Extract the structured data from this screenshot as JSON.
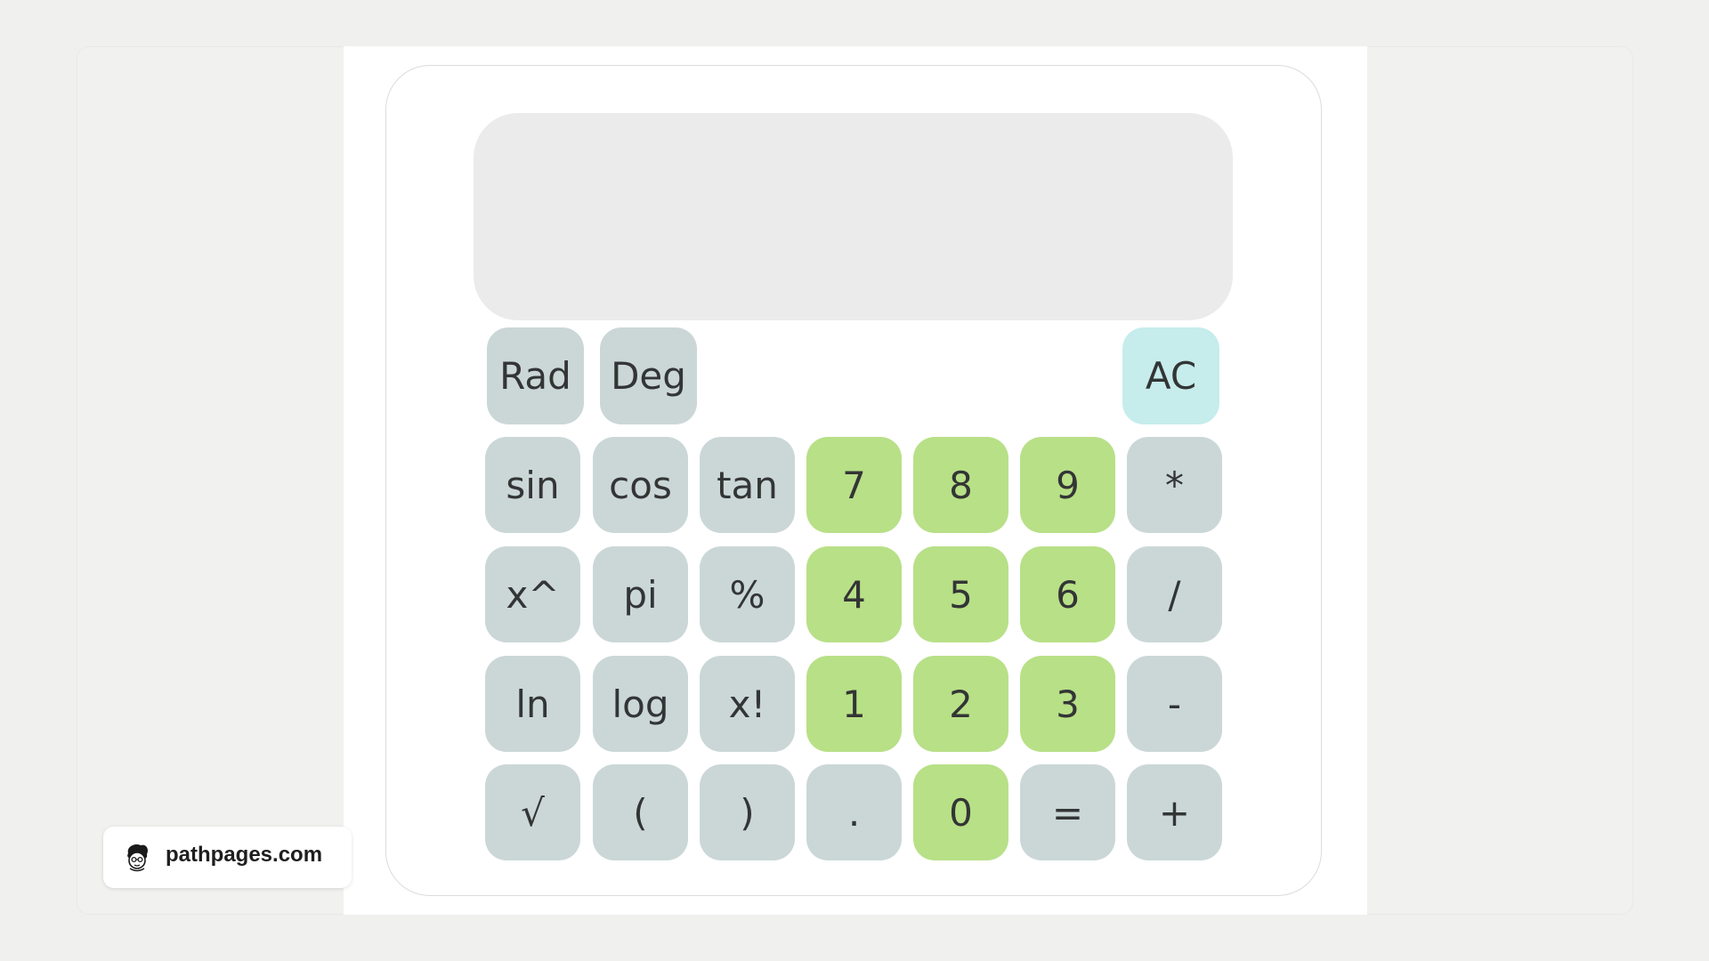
{
  "display": {
    "value": ""
  },
  "mode_keys": [
    {
      "label": "Rad"
    },
    {
      "label": "Deg"
    }
  ],
  "clear_key": {
    "label": "AC"
  },
  "rows": [
    [
      {
        "label": "sin"
      },
      {
        "label": "cos"
      },
      {
        "label": "tan"
      },
      {
        "label": "7"
      },
      {
        "label": "8"
      },
      {
        "label": "9"
      },
      {
        "label": "*"
      }
    ],
    [
      {
        "label": "x^"
      },
      {
        "label": "pi"
      },
      {
        "label": "%"
      },
      {
        "label": "4"
      },
      {
        "label": "5"
      },
      {
        "label": "6"
      },
      {
        "label": "/"
      }
    ],
    [
      {
        "label": "ln"
      },
      {
        "label": "log"
      },
      {
        "label": "x!"
      },
      {
        "label": "1"
      },
      {
        "label": "2"
      },
      {
        "label": "3"
      },
      {
        "label": "-"
      }
    ],
    [
      {
        "label": "√"
      },
      {
        "label": "("
      },
      {
        "label": ")"
      },
      {
        "label": "."
      },
      {
        "label": "0"
      },
      {
        "label": "="
      },
      {
        "label": "+"
      }
    ]
  ],
  "colors": {
    "function_key": "#cbd7d7",
    "number_key": "#b8e087",
    "clear_key": "#c6ecec",
    "display": "#ebebeb"
  },
  "badge": {
    "text": "pathpages.com",
    "icon": "avatar-icon"
  }
}
